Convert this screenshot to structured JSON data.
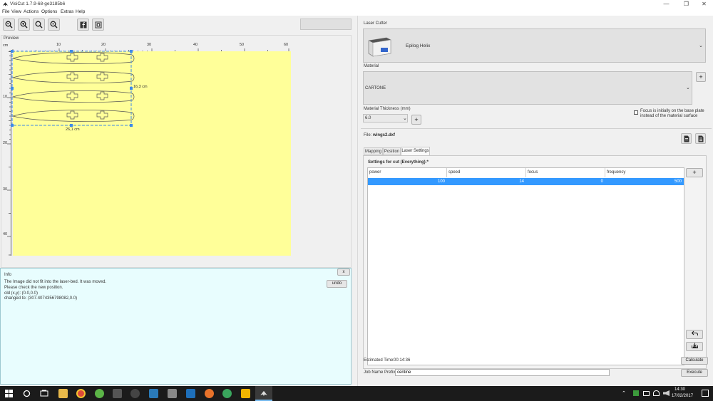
{
  "window": {
    "title": "VisiCut 1.7.9-68-ge3185b6",
    "min": "—",
    "max": "❐",
    "close": "✕"
  },
  "menu": [
    "File",
    "View",
    "Actions",
    "Options",
    "Extras",
    "Help"
  ],
  "preview": {
    "label": "Preview",
    "unit": "cm",
    "h_ticks": [
      "10",
      "20",
      "30",
      "40",
      "50",
      "60"
    ],
    "v_ticks": [
      "10",
      "20",
      "30",
      "40"
    ],
    "width_label": "26,1 cm",
    "height_label": "16,3 cm"
  },
  "info": {
    "label": "Info",
    "close": "x",
    "undo": "undo",
    "lines": [
      "The Image did not fit into the laser-bed. It was moved.",
      "Please check the new position.",
      "old (x,y): (0.0,0.0)",
      "changed to: (307.4074356798082,0.0)"
    ]
  },
  "laser": {
    "label": "Laser Cutter",
    "name": "Epilog Helix"
  },
  "material": {
    "label": "Material",
    "name": "CARTONE",
    "add": "+"
  },
  "thickness": {
    "label": "Material Thickness (mm)",
    "value": "6.0",
    "add": "+"
  },
  "focus_note": {
    "line1": "Focus is initially on the base plate",
    "line2": "instead of the material surface"
  },
  "file": {
    "label": "File:",
    "name": "wings2.dxf"
  },
  "tabs": [
    "Mapping",
    "Position",
    "Laser Settings"
  ],
  "settings": {
    "title": "Settings for cut (Everything):*",
    "columns": [
      "power",
      "speed",
      "focus",
      "frequency"
    ],
    "rows": [
      [
        "100",
        "14",
        "0",
        "500"
      ]
    ],
    "add": "+"
  },
  "estimate": {
    "label": "Estimated Time:",
    "value": "00:14:36"
  },
  "calculate": "Calculate",
  "prefix": {
    "label": "Job Name Prefix:",
    "value": "centine"
  },
  "execute": "Execute",
  "taskbar": {
    "time": "14:30",
    "date": "17/02/2017"
  },
  "colors": {
    "bed": "#ffff99",
    "info_bg": "#e8fdfe",
    "selection": "#3d8ae8",
    "accent_blue": "#3399ff"
  }
}
